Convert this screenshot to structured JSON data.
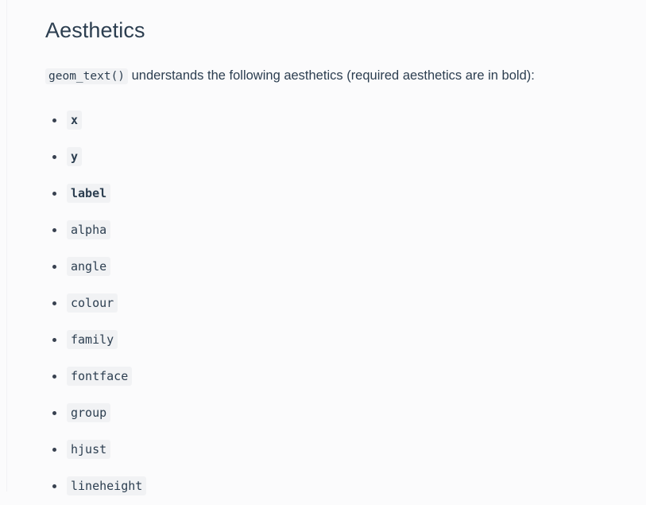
{
  "section": {
    "title": "Aesthetics",
    "intro": {
      "code": "geom_text()",
      "text": " understands the following aesthetics (required aesthetics are in bold):"
    }
  },
  "aesthetics": [
    {
      "name": "x",
      "required": true
    },
    {
      "name": "y",
      "required": true
    },
    {
      "name": "label",
      "required": true
    },
    {
      "name": "alpha",
      "required": false
    },
    {
      "name": "angle",
      "required": false
    },
    {
      "name": "colour",
      "required": false
    },
    {
      "name": "family",
      "required": false
    },
    {
      "name": "fontface",
      "required": false
    },
    {
      "name": "group",
      "required": false
    },
    {
      "name": "hjust",
      "required": false
    },
    {
      "name": "lineheight",
      "required": false
    }
  ],
  "colors": {
    "background": "#fbfbfc",
    "text": "#2c3e50",
    "code_background": "#f1f2f4",
    "bullet": "#384150",
    "rule": "#f2f2f4"
  }
}
